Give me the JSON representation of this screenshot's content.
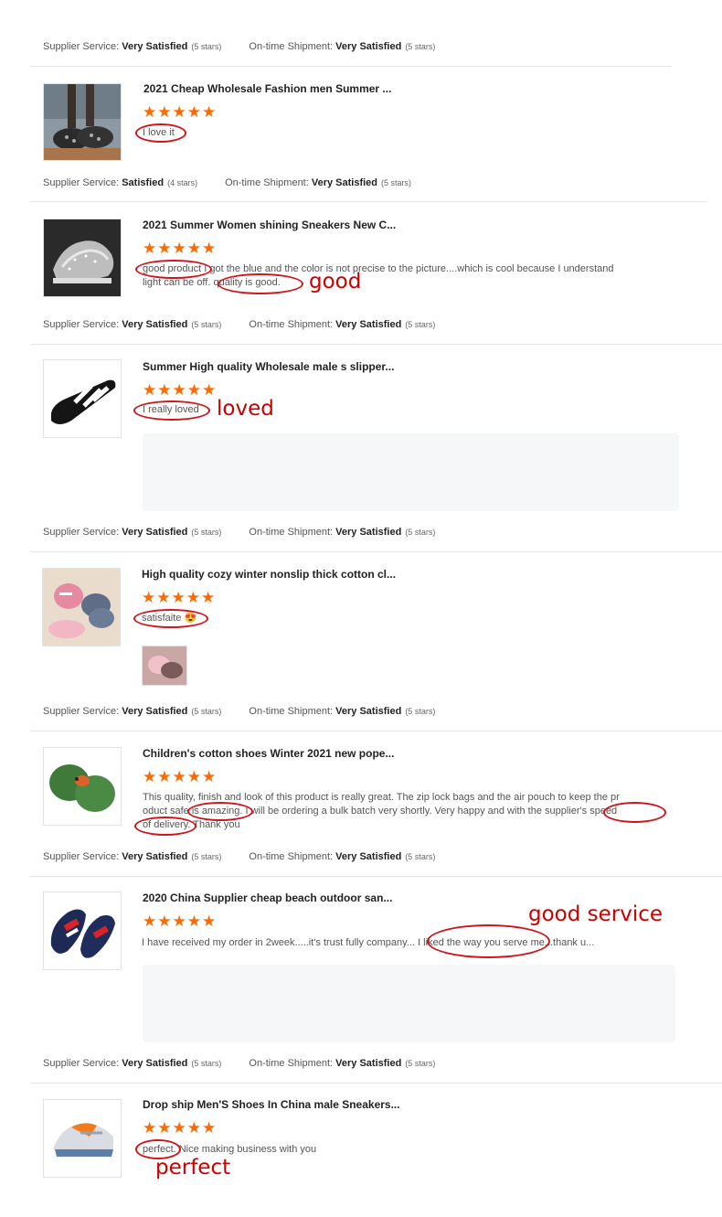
{
  "labels": {
    "supplier_service": "Supplier Service:",
    "ontime_shipment": "On-time Shipment:"
  },
  "stars": "★★★★★",
  "ratings": [
    {
      "supplier": "Very Satisfied",
      "supplier_stars": "(5 stars)",
      "shipment": "Very Satisfied",
      "shipment_stars": "(5 stars)"
    },
    {
      "supplier": "Satisfied",
      "supplier_stars": "(4 stars)",
      "shipment": "Very Satisfied",
      "shipment_stars": "(5 stars)"
    },
    {
      "supplier": "Very Satisfied",
      "supplier_stars": "(5 stars)",
      "shipment": "Very Satisfied",
      "shipment_stars": "(5 stars)"
    },
    {
      "supplier": "Very Satisfied",
      "supplier_stars": "(5 stars)",
      "shipment": "Very Satisfied",
      "shipment_stars": "(5 stars)"
    },
    {
      "supplier": "Very Satisfied",
      "supplier_stars": "(5 stars)",
      "shipment": "Very Satisfied",
      "shipment_stars": "(5 stars)"
    },
    {
      "supplier": "Very Satisfied",
      "supplier_stars": "(5 stars)",
      "shipment": "Very Satisfied",
      "shipment_stars": "(5 stars)"
    },
    {
      "supplier": "Very Satisfied",
      "supplier_stars": "(5 stars)",
      "shipment": "Very Satisfied",
      "shipment_stars": "(5 stars)"
    }
  ],
  "reviews": [
    {
      "title": "2021 Cheap Wholesale Fashion men Summer ...",
      "text": "I love it",
      "image": "sandal-photo"
    },
    {
      "title": "2021 Summer Women shining Sneakers New C...",
      "text_line1": "good product I got the blue and the color is not precise to the picture....which is cool because I understand",
      "text_line2": "light can be off. quality is good.",
      "image": "sneaker-photo",
      "annotation": "good"
    },
    {
      "title": "Summer High quality Wholesale male s slipper...",
      "text": "I really loved",
      "image": "slipper-photo",
      "annotation": "loved"
    },
    {
      "title": "High quality cozy winter nonslip thick cotton cl...",
      "text": "satisfaite 😍",
      "image": "winter-slippers-photo"
    },
    {
      "title": "Children's cotton shoes Winter 2021 new pope...",
      "text_line1": "This quality, finish and look of this product is really great. The zip lock bags and the air pouch to keep the pr",
      "text_line2": "oduct safe is amazing. I will be ordering a bulk batch very shortly. Very happy and with the supplier's speed",
      "text_line3": "of delivery. Thank you",
      "image": "green-slippers-photo"
    },
    {
      "title": "2020 China Supplier cheap beach outdoor san...",
      "text": "I have received my order in 2week.....it's trust fully company... I liked the way you serve me...thank u...",
      "image": "beach-sandal-photo",
      "annotation": "good service"
    },
    {
      "title": "Drop ship Men'S Shoes In China male Sneakers...",
      "text": "perfect. Nice making business with you",
      "image": "men-sneaker-photo",
      "annotation": "perfect"
    }
  ],
  "colors": {
    "star": "#ff6a00",
    "annotation": "#cc0000",
    "divider": "#e6e6e6"
  }
}
